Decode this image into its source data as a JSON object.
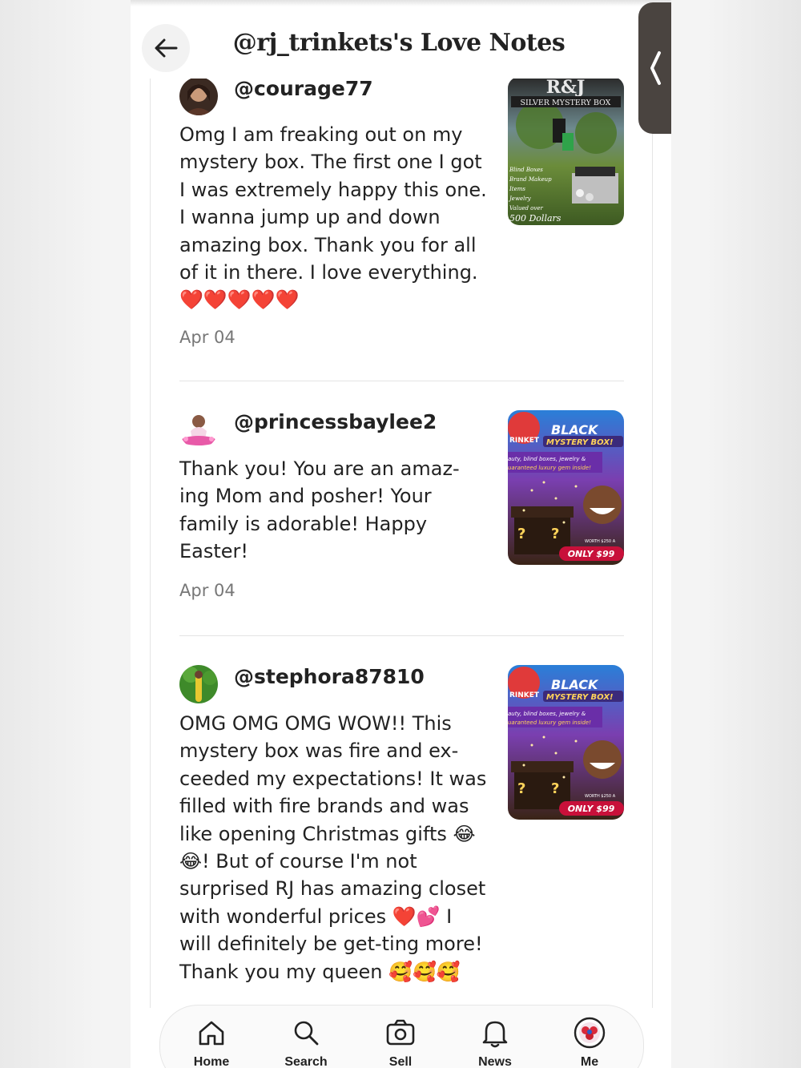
{
  "header": {
    "title": "@rj_trinkets's Love Notes"
  },
  "notes": [
    {
      "username": "@courage77",
      "message": "Omg I am freaking out on my mystery box. The first one I got I was extremely happy this one. I wanna jump up and down amazing box. Thank you for all of it in there. I love everything.❤️❤️❤️❤️❤️",
      "date": "Apr 04",
      "thumb": {
        "brand": "R&J",
        "title": "SILVER MYSTERY BOX",
        "bullets": [
          "Blind Boxes",
          "Brand Makeup",
          "Items",
          "Jewelry",
          "Valued over"
        ],
        "price": "500 Dollars"
      }
    },
    {
      "username": "@princessbaylee2",
      "message": "Thank you! You are an amaz-ing Mom and posher! Your family is adorable! Happy Easter!",
      "date": "Apr 04",
      "thumb": {
        "brand": "RINKET",
        "title_1": "BLACK",
        "title_2": "MYSTERY BOX!",
        "tagline_1": "auty, blind boxes, jewelry &",
        "tagline_2": "uaranteed luxury gem inside!",
        "worth": "WORTH $250 A",
        "price": "ONLY $99"
      }
    },
    {
      "username": "@stephora87810",
      "message": "OMG OMG OMG WOW!! This mystery box was fire and ex-ceeded my expectations! It was filled with fire brands and was like opening Christmas gifts 😂😂! But of course I'm not surprised RJ has amazing closet with wonderful prices ❤️💕 I will definitely be get-ting more! Thank you my queen 🥰🥰🥰",
      "thumb": {
        "brand": "RINKET",
        "title_1": "BLACK",
        "title_2": "MYSTERY BOX!",
        "tagline_1": "auty, blind boxes, jewelry &",
        "tagline_2": "uaranteed luxury gem inside!",
        "worth": "WORTH $250 A",
        "price": "ONLY $99"
      }
    }
  ],
  "nav": {
    "home": "Home",
    "search": "Search",
    "sell": "Sell",
    "news": "News",
    "me": "Me"
  },
  "colors": {
    "text": "#222222",
    "muted": "#777777",
    "divider": "#e4e4e4",
    "side_tab": "#4a4440"
  }
}
